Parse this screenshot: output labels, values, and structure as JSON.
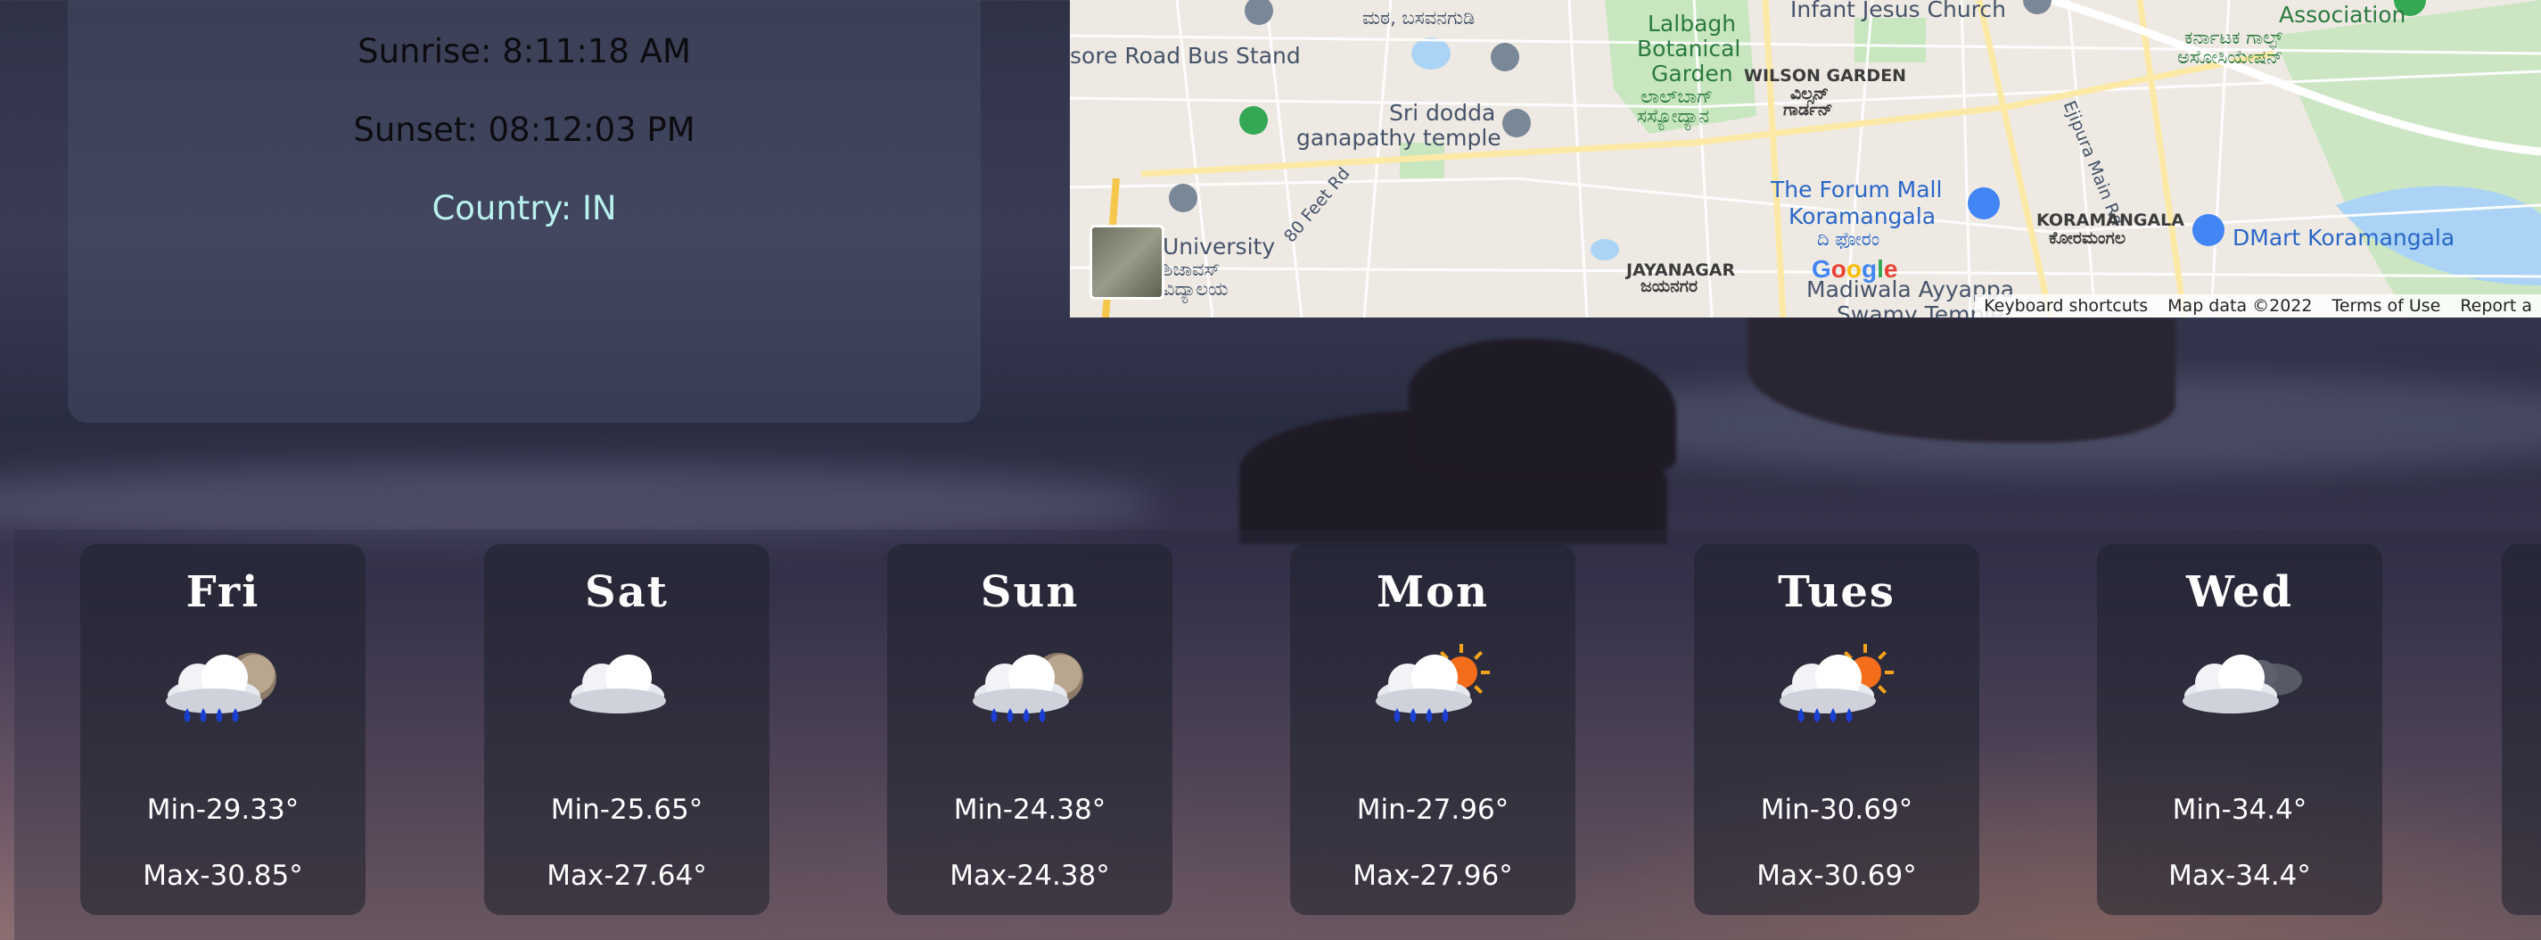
{
  "info": {
    "sunrise": "Sunrise: 8:11:18 AM",
    "sunset": "Sunset: 08:12:03 PM",
    "country": "Country: IN"
  },
  "map": {
    "labels": {
      "bus_stand": "sore Road Bus Stand",
      "lalbagh": "Lalbagh",
      "botanical": "Botanical",
      "garden": "Garden",
      "lalbagh_kn": "ಲಾಲ್‌ಬಾಗ್",
      "botanical_kn": "ಸಸ್ಯೋದ್ಯಾನ",
      "infant_jesus": "Infant Jesus Church",
      "association": "Association",
      "association_kn1": "ಕರ್ನಾಟಕ ಗಾಲ್ಫ್",
      "association_kn2": "ಅಸೋಸಿಯೇಷನ್",
      "wilson_garden": "WILSON GARDEN",
      "wilson_garden_kn1": "ವಿಲ್ಸನ್",
      "wilson_garden_kn2": "ಗಾರ್ಡನ್",
      "ejipura": "Ejipura Main Rd",
      "sri_dodda": "Sri dodda",
      "ganapathy": "ganapathy temple",
      "basavanagudi_kn": "ಮಠ, ಬಸವನಗುಡಿ",
      "forum_mall": "The Forum Mall",
      "koramangala": "Koramangala",
      "forum_kn": "ದಿ ಫೋರಂ",
      "koramangala_caps": "KORAMANGALA",
      "koramangala_kn": "ಕೋರಮಂಗಲ",
      "dmart": "DMart Koramangala",
      "university": "University",
      "university_kn1": "ಶಿಜಾವಸ್",
      "university_kn2": "ವಿದ್ಯಾಲಯ",
      "feet_rd": "80 Feet Rd",
      "jayanagar": "JAYANAGAR",
      "jayanagar_kn": "ಜಯನಗರ",
      "madiwala": "Madiwala Ayyappa",
      "swamy": "Swamy Temple"
    },
    "google": "Google",
    "footer": {
      "shortcuts": "Keyboard shortcuts",
      "mapdata": "Map data ©2022",
      "terms": "Terms of Use",
      "report": "Report a"
    },
    "colors": {
      "park": "#c8e6c0",
      "water": "#aad3f5",
      "road": "#ffffff",
      "major_road": "#fde9a6"
    }
  },
  "forecast": [
    {
      "day": "Fri",
      "icon": "rain-cloud-moon-icon",
      "min": "Min-29.33°",
      "max": "Max-30.85°"
    },
    {
      "day": "Sat",
      "icon": "cloud-icon",
      "min": "Min-25.65°",
      "max": "Max-27.64°"
    },
    {
      "day": "Sun",
      "icon": "rain-cloud-moon-icon",
      "min": "Min-24.38°",
      "max": "Max-24.38°"
    },
    {
      "day": "Mon",
      "icon": "rain-cloud-sun-icon",
      "min": "Min-27.96°",
      "max": "Max-27.96°"
    },
    {
      "day": "Tues",
      "icon": "rain-cloud-sun-icon",
      "min": "Min-30.69°",
      "max": "Max-30.69°"
    },
    {
      "day": "Wed",
      "icon": "cloud-dark-cloud-icon",
      "min": "Min-34.4°",
      "max": "Max-34.4°"
    }
  ]
}
